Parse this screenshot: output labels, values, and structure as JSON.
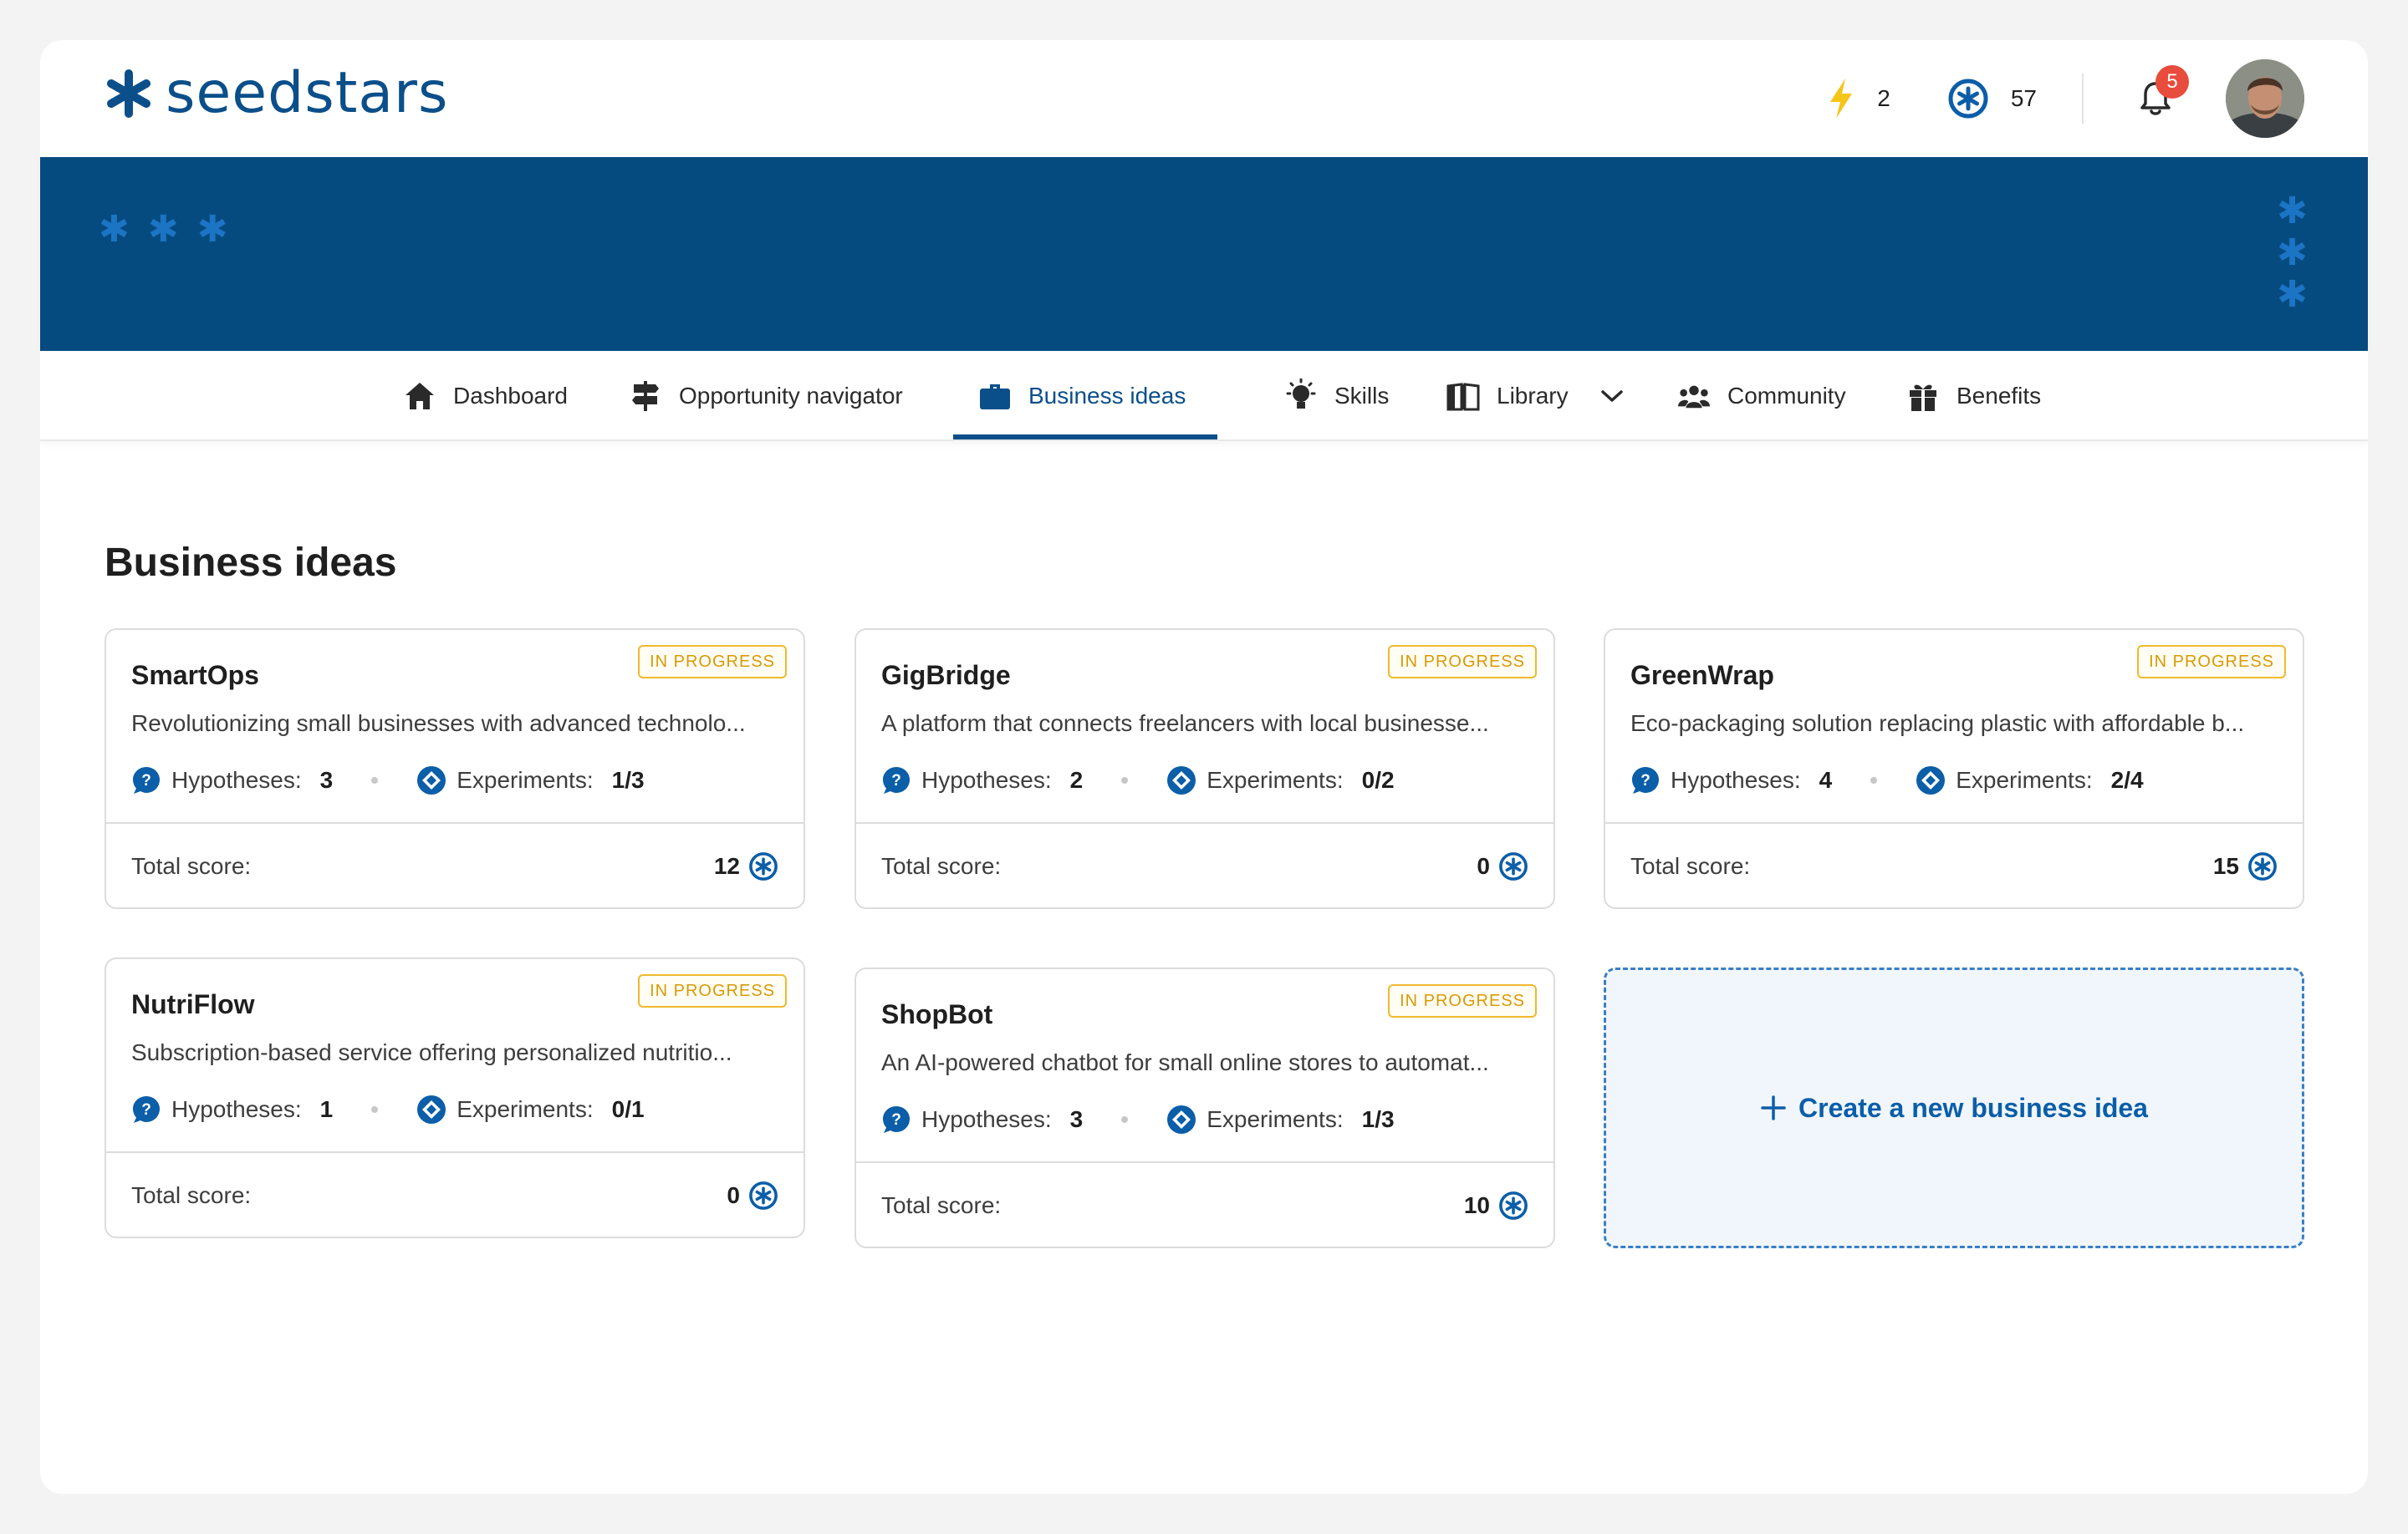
{
  "app": {
    "brand": "seedstars"
  },
  "header": {
    "energy_count": "2",
    "stars_count": "57",
    "notifications_count": "5"
  },
  "nav": {
    "items": [
      {
        "label": "Dashboard",
        "icon": "home-icon"
      },
      {
        "label": "Opportunity navigator",
        "icon": "signpost-icon"
      },
      {
        "label": "Business ideas",
        "icon": "briefcase-icon",
        "active": true
      },
      {
        "label": "Skills",
        "icon": "lightbulb-icon"
      },
      {
        "label": "Library",
        "icon": "book-icon",
        "has_dropdown": true
      },
      {
        "label": "Community",
        "icon": "people-icon"
      },
      {
        "label": "Benefits",
        "icon": "gift-icon"
      }
    ]
  },
  "main": {
    "title": "Business ideas",
    "hypotheses_label": "Hypotheses:",
    "experiments_label": "Experiments:",
    "total_score_label": "Total score:",
    "status_label": "IN PROGRESS",
    "cards": [
      {
        "name": "SmartOps",
        "description": "Revolutionizing small businesses with advanced technolo...",
        "hypotheses": "3",
        "experiments": "1/3",
        "score": "12",
        "status": "IN PROGRESS"
      },
      {
        "name": "GigBridge",
        "description": "A platform that connects freelancers with local businesse...",
        "hypotheses": "2",
        "experiments": "0/2",
        "score": "0",
        "status": "IN PROGRESS"
      },
      {
        "name": "GreenWrap",
        "description": "Eco-packaging solution replacing plastic with affordable b...",
        "hypotheses": "4",
        "experiments": "2/4",
        "score": "15",
        "status": "IN PROGRESS"
      },
      {
        "name": "NutriFlow",
        "description": "Subscription-based service offering personalized nutritio...",
        "hypotheses": "1",
        "experiments": "0/1",
        "score": "0",
        "status": "IN PROGRESS"
      },
      {
        "name": "ShopBot",
        "description": "An AI-powered chatbot for small online stores to automat...",
        "hypotheses": "3",
        "experiments": "1/3",
        "score": "10",
        "status": "IN PROGRESS"
      }
    ],
    "create_label": "Create a new business idea"
  },
  "colors": {
    "brand": "#0b4f8a",
    "banner": "#064b80",
    "badge": "#f0b92d",
    "notification": "#e74c3c"
  }
}
